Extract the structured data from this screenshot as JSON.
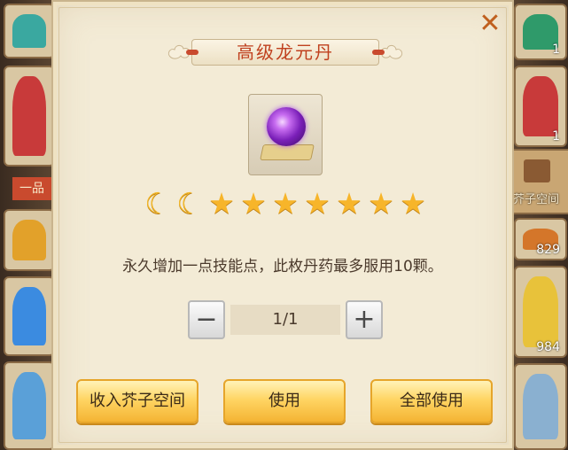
{
  "modal": {
    "title": "高级龙元丹",
    "close_icon": "close-icon",
    "item_icon": "purple-elixir-pill-icon",
    "moons": 2,
    "stars": 7,
    "description": "永久增加一点技能点，此枚丹药最多服用10颗。",
    "quantity": "1/1",
    "minus_label": "−",
    "plus_label": "+",
    "buttons": {
      "store": "收入芥子空间",
      "use": "使用",
      "use_all": "全部使用"
    },
    "colors": {
      "title": "#c0401e",
      "close": "#c0601f",
      "button_gold": "#ffd564",
      "star": "#f7b52a"
    }
  },
  "background": {
    "left_ribbon": "一品",
    "right_space_label": "芥子空间",
    "right_numbers": [
      "1",
      "1",
      "829",
      "984"
    ]
  }
}
